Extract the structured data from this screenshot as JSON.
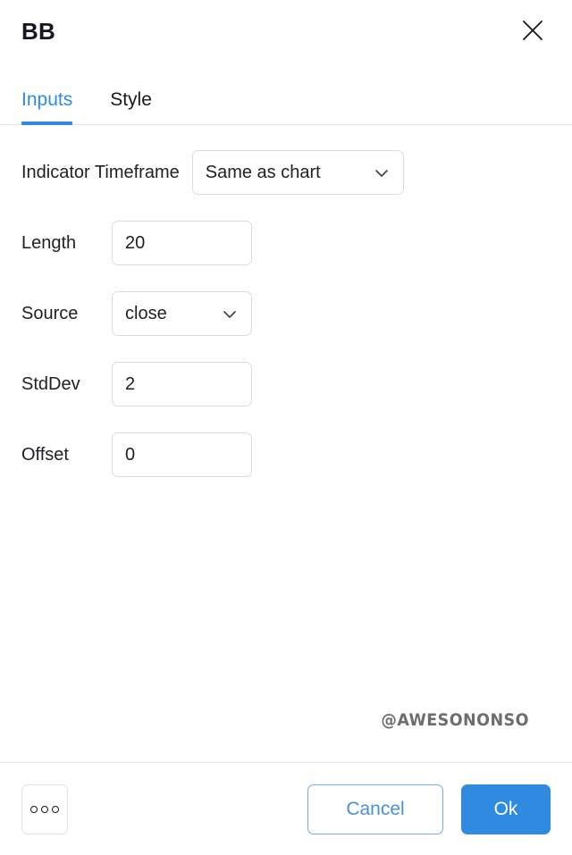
{
  "dialog": {
    "title": "BB",
    "close_icon": "close-icon"
  },
  "tabs": [
    {
      "label": "Inputs",
      "active": true
    },
    {
      "label": "Style",
      "active": false
    }
  ],
  "form": {
    "timeframe": {
      "label": "Indicator Timeframe",
      "value": "Same as chart",
      "chevron_icon": "chevron-down-icon"
    },
    "length": {
      "label": "Length",
      "value": "20",
      "placeholder": "20"
    },
    "source": {
      "label": "Source",
      "value": "close",
      "chevron_icon": "chevron-down-icon"
    },
    "stddev": {
      "label": "StdDev",
      "value": "2",
      "placeholder": "2"
    },
    "offset": {
      "label": "Offset",
      "value": "0",
      "placeholder": "0"
    }
  },
  "watermark": {
    "text": "@AWESONONSO"
  },
  "footer": {
    "more_label": "",
    "more_icon": "more-horizontal-icon",
    "cancel_label": "Cancel",
    "ok_label": "Ok"
  },
  "colors": {
    "accent": "#2f8ae0",
    "cancel_text": "#4a90d9",
    "cancel_border": "#74a9dd",
    "text": "#1e2027",
    "border": "#dadce0",
    "divider": "#e6e8ea",
    "watermark": "#6d6d6d"
  }
}
